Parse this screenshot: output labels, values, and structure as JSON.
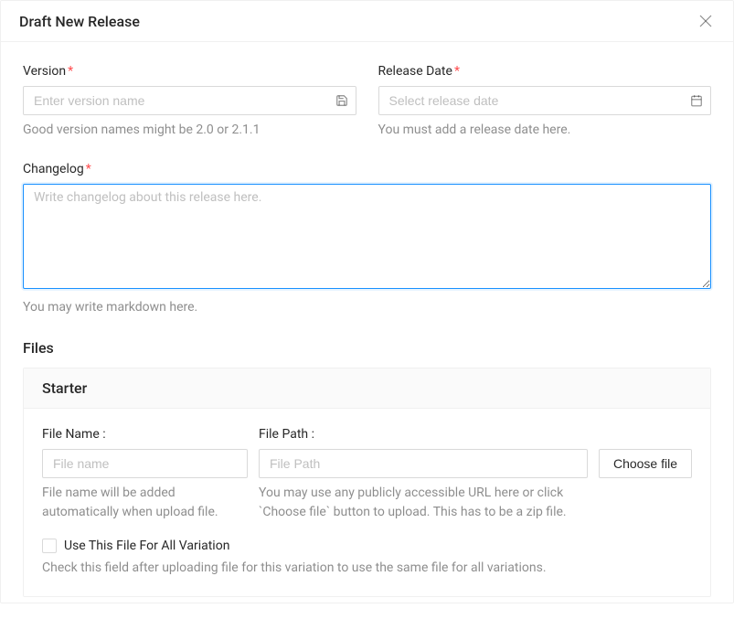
{
  "header": {
    "title": "Draft New Release"
  },
  "form": {
    "version": {
      "label": "Version",
      "placeholder": "Enter version name",
      "help": "Good version names might be 2.0 or 2.1.1"
    },
    "release_date": {
      "label": "Release Date",
      "placeholder": "Select release date",
      "help": "You must add a release date here."
    },
    "changelog": {
      "label": "Changelog",
      "placeholder": "Write changelog about this release here.",
      "help": "You may write markdown here."
    }
  },
  "files": {
    "section_title": "Files",
    "variation_name": "Starter",
    "file_name": {
      "label": "File Name :",
      "placeholder": "File name",
      "help": "File name will be added automatically when upload file."
    },
    "file_path": {
      "label": "File Path :",
      "placeholder": "File Path",
      "help": "You may use any publicly accessible URL here or click `Choose file` button to upload. This has to be a zip file."
    },
    "choose_file_label": "Choose file",
    "use_for_all": {
      "label": "Use This File For All Variation",
      "help": "Check this field after uploading file for this variation to use the same file for all variations."
    }
  }
}
